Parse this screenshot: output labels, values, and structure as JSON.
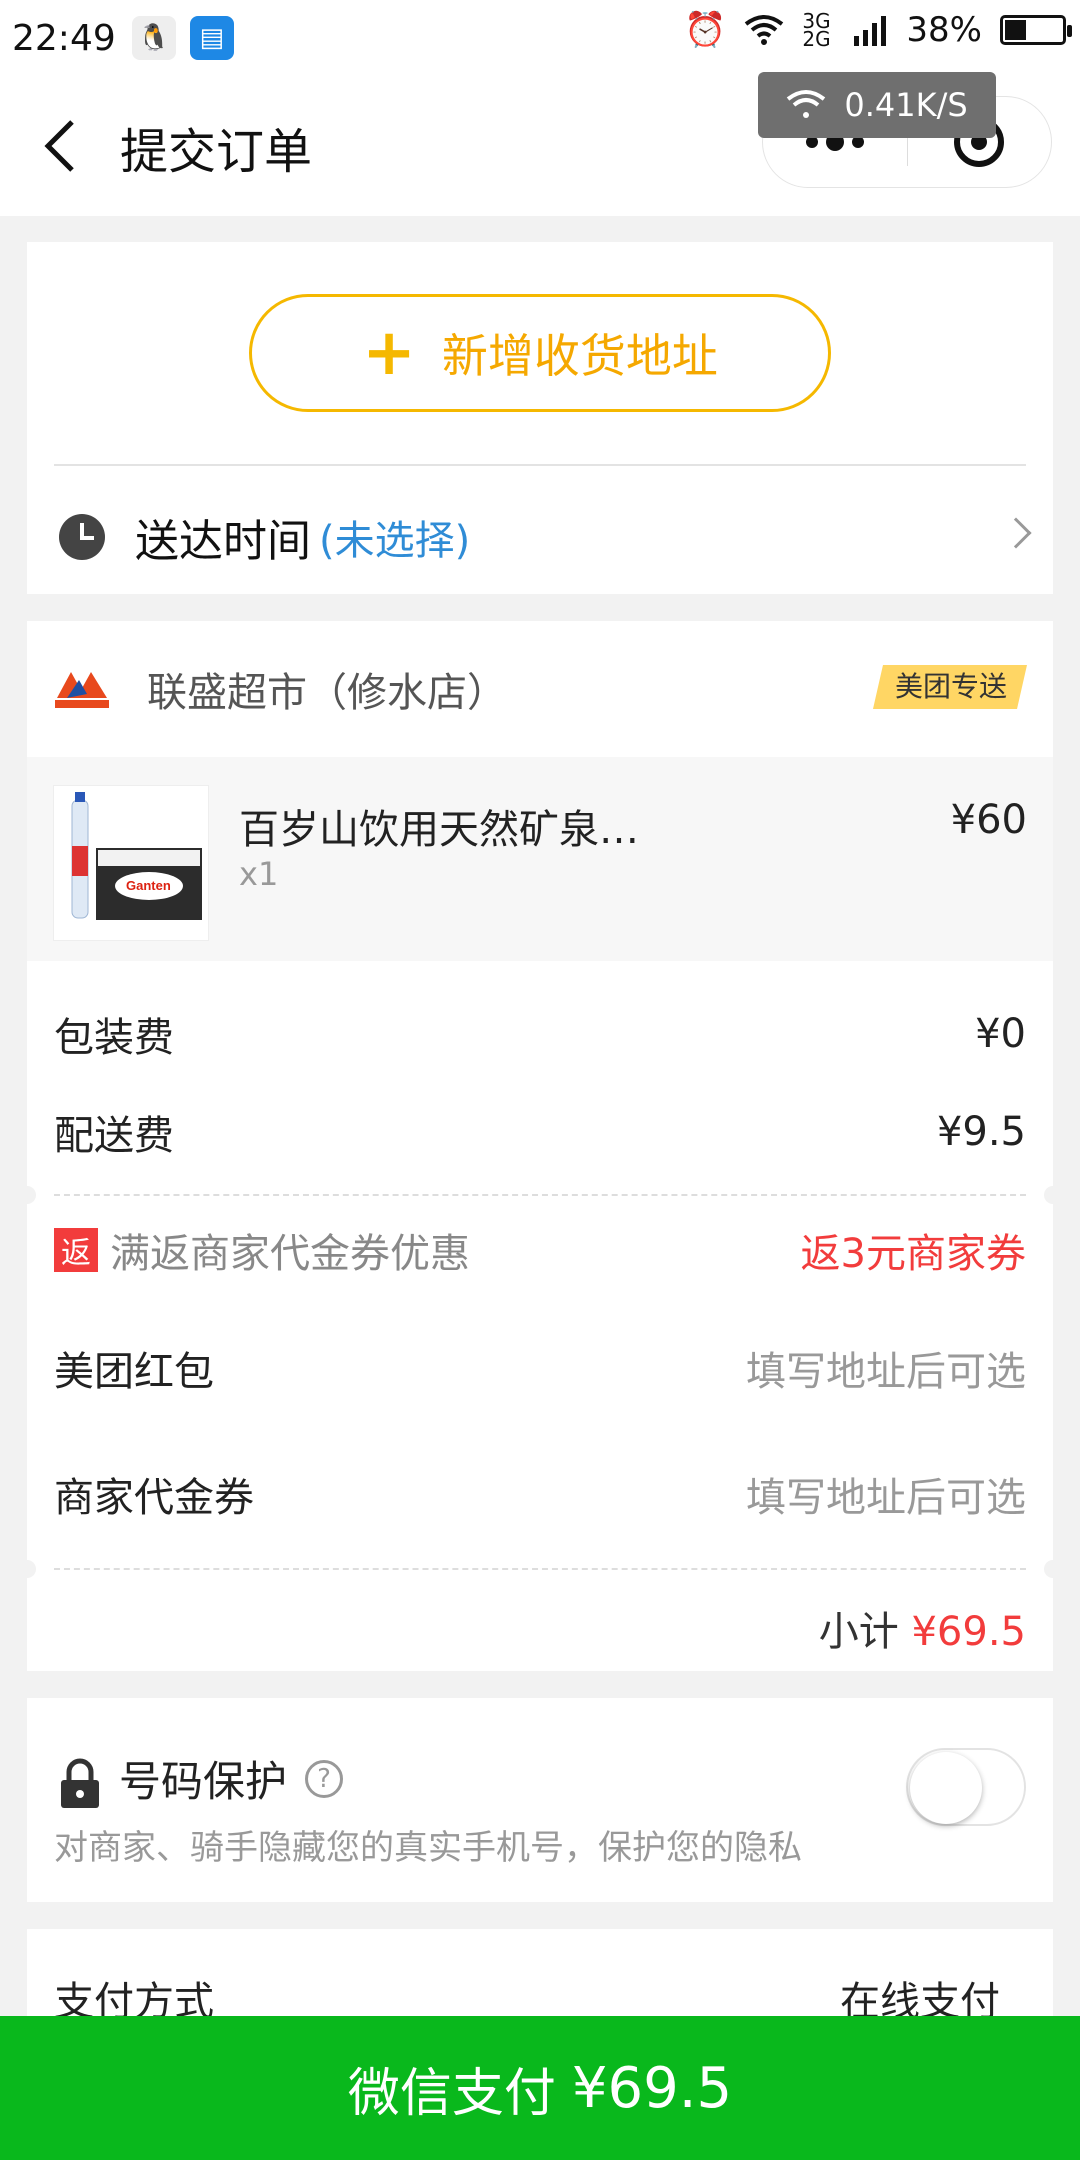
{
  "status_bar": {
    "time": "22:49",
    "network": "3G 2G",
    "battery": "38%",
    "battery_level": 0.38
  },
  "net_toast": {
    "speed": "0.41K/S"
  },
  "nav": {
    "title": "提交订单"
  },
  "address": {
    "add_label": "新增收货地址",
    "plus": "+"
  },
  "delivery_time": {
    "label": "送达时间",
    "status": "(未选择)"
  },
  "shop": {
    "name": "联盛超市（修水店）",
    "badge": "美团专送"
  },
  "item": {
    "name": "百岁山饮用天然矿泉…",
    "qty": "x1",
    "price": "¥60"
  },
  "fees": {
    "packing_label": "包装费",
    "packing_value": "¥0",
    "delivery_label": "配送费",
    "delivery_value": "¥9.5"
  },
  "promos": {
    "return_badge": "返",
    "return_label": "满返商家代金券优惠",
    "return_value": "返3元商家券",
    "redpacket_label": "美团红包",
    "redpacket_value": "填写地址后可选",
    "voucher_label": "商家代金券",
    "voucher_value": "填写地址后可选"
  },
  "subtotal": {
    "label": "小计",
    "amount": "¥69.5"
  },
  "privacy": {
    "title": "号码保护",
    "help": "?",
    "desc": "对商家、骑手隐藏您的真实手机号，保护您的隐私",
    "enabled": false
  },
  "payment": {
    "label": "支付方式",
    "value": "在线支付"
  },
  "pay_button": {
    "label": "微信支付",
    "amount": "¥69.5"
  },
  "colors": {
    "accent_yellow": "#f5b800",
    "link_blue": "#2f8cd6",
    "red": "#f23c3c",
    "wechat_green": "#09b81c"
  }
}
